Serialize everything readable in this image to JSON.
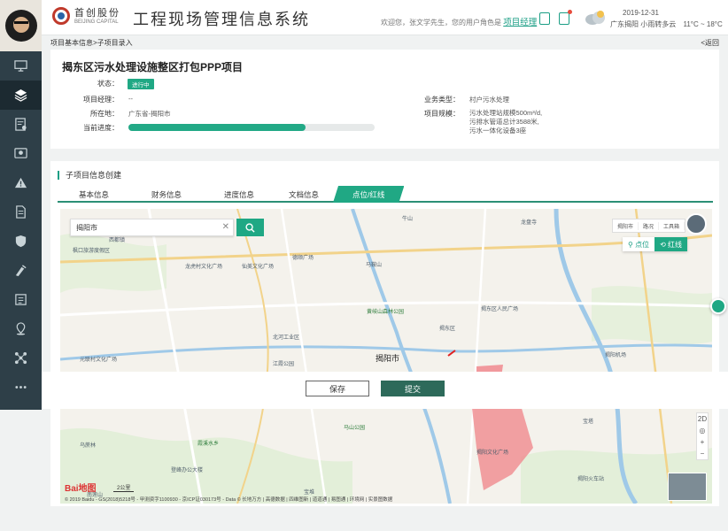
{
  "sidebar": {
    "items": [
      {
        "icon": "monitor-icon"
      },
      {
        "icon": "layers-icon",
        "active": true
      },
      {
        "icon": "report-icon"
      },
      {
        "icon": "screen-icon"
      },
      {
        "icon": "warning-icon"
      },
      {
        "icon": "document-icon"
      },
      {
        "icon": "shield-icon"
      },
      {
        "icon": "tools-icon"
      },
      {
        "icon": "list-icon"
      },
      {
        "icon": "location-icon"
      },
      {
        "icon": "network-icon"
      },
      {
        "icon": "more-icon"
      }
    ]
  },
  "header": {
    "logo_cn": "首创股份",
    "logo_en": "BEIJING CAPITAL",
    "system_title": "工程现场管理信息系统",
    "welcome": "欢迎您，张文学先生，您的用户角色是",
    "role": "项目经理",
    "date": "2019-12-31",
    "location": "广东揭阳",
    "weather": "小雨转多云",
    "temperature": "11°C ~ 18°C"
  },
  "breadcrumb": "项目基本信息>子项目录入",
  "back_label": "<返回",
  "project": {
    "title": "揭东区污水处理设施整区打包PPP项目",
    "status_label": "状态：",
    "status_value": "进行中",
    "manager_label": "项目经理：",
    "manager_value": "--",
    "address_label": "所在地：",
    "address_value": "广东省-揭阳市",
    "progress_label": "当前进度：",
    "progress_value": 0.72,
    "business_label": "业务类型：",
    "business_value": "村户污水处理",
    "scale_label": "项目规模：",
    "scale_lines": [
      "污水处理站规模500m³/d,",
      "污排水管道总计3588米,",
      "污水一体化设备3座"
    ]
  },
  "subproject": {
    "section_title": "子项目信息创建",
    "tabs": [
      "基本信息",
      "财务信息",
      "进度信息",
      "文档信息",
      "点位/红线"
    ],
    "active_tab": "点位/红线"
  },
  "map": {
    "search_value": "揭阳市",
    "tools": [
      "揭阳市",
      "路况",
      "工具箱"
    ],
    "mode_point": "点位",
    "mode_redline": "红线",
    "labels": {
      "city": "揭阳市",
      "district": "揭东区",
      "l1": "西都镇",
      "l2": "枫口旅游度假区",
      "l3": "龙虎村文化广场",
      "l4": "仙美文化广场",
      "l5": "德顺广场",
      "l6": "马鞍山",
      "l7": "黄岐山森林公园",
      "l8": "揭东区人民广场",
      "l9": "北河工业区",
      "l10": "元联村文化广场",
      "l11": "揭阳文化广场",
      "l12": "乌蔗林",
      "l13": "霞溪水乡",
      "l14": "宝塔",
      "l15": "揭阳机场",
      "l16": "龙盘寺",
      "l17": "牛山",
      "l18": "江霞公园",
      "l19": "南莲山",
      "l20": "马山公园",
      "l21": "登峰办公大楼",
      "l22": "宝堆",
      "l23": "揭阳火车站"
    },
    "baidu": "Bai地图",
    "scale": "2公里",
    "copyright": "© 2019 Baidu - GS(2018)5218号 - 甲测资字1100930 - 京ICP证030173号 - Data © 长地万方 | 高德数据 | 四维图新 | 道道通 | 易图通 | 环境网 | 实景图数据"
  },
  "actions": {
    "save": "保存",
    "submit": "提交"
  },
  "colors": {
    "accent": "#1fa884",
    "sidebar": "#2e3f48",
    "redline": "#f08a8f"
  }
}
